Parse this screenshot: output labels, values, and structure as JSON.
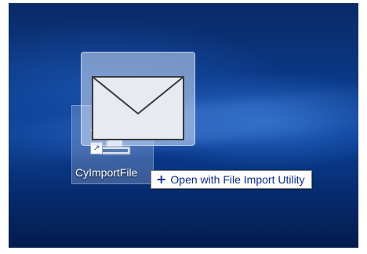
{
  "desktop": {
    "icon": {
      "label": "CyImportFile",
      "icon_name": "file-import-app-icon",
      "shortcut_icon_name": "shortcut-arrow-icon",
      "shortcut_glyph": "↗"
    },
    "drag_ghost": {
      "icon_name": "envelope-icon"
    },
    "drop_tooltip": {
      "plus_glyph": "+",
      "plus_icon_name": "plus-icon",
      "text": "Open with File Import Utility"
    }
  },
  "colors": {
    "wallpaper": "#0b3f95",
    "tooltip_text": "#0a2a9a",
    "tooltip_border": "#767676"
  }
}
